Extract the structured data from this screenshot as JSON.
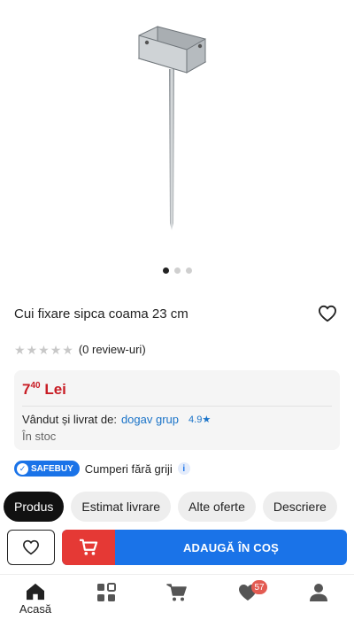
{
  "gallery": {
    "total_images": 3,
    "active_index": 0
  },
  "product": {
    "title": "Cui fixare sipca coama 23 cm",
    "rating_stars": 0,
    "review_count_text": "(0 review-uri)"
  },
  "price": {
    "integer": "7",
    "cents": "40",
    "currency": "Lei",
    "color": "#c81d25"
  },
  "seller": {
    "label": "Vândut și livrat de:",
    "name": "dogav grup",
    "rating": "4.9",
    "stock": "În stoc"
  },
  "safebuy": {
    "badge": "SAFEBUY",
    "text": "Cumperi fără griji",
    "info_icon": "i"
  },
  "tabs": [
    {
      "label": "Produs",
      "active": true
    },
    {
      "label": "Estimat livrare",
      "active": false
    },
    {
      "label": "Alte oferte",
      "active": false
    },
    {
      "label": "Descriere",
      "active": false
    }
  ],
  "actions": {
    "add_to_cart_label": "ADAUGĂ ÎN COȘ",
    "accent": "#1a73e8",
    "cart_icon_bg": "#e53935"
  },
  "bottom_nav": {
    "home_label": "Acasă",
    "favorites_badge": "57",
    "icons": [
      "home-icon",
      "categories-icon",
      "cart-icon",
      "heart-icon",
      "user-icon"
    ]
  }
}
